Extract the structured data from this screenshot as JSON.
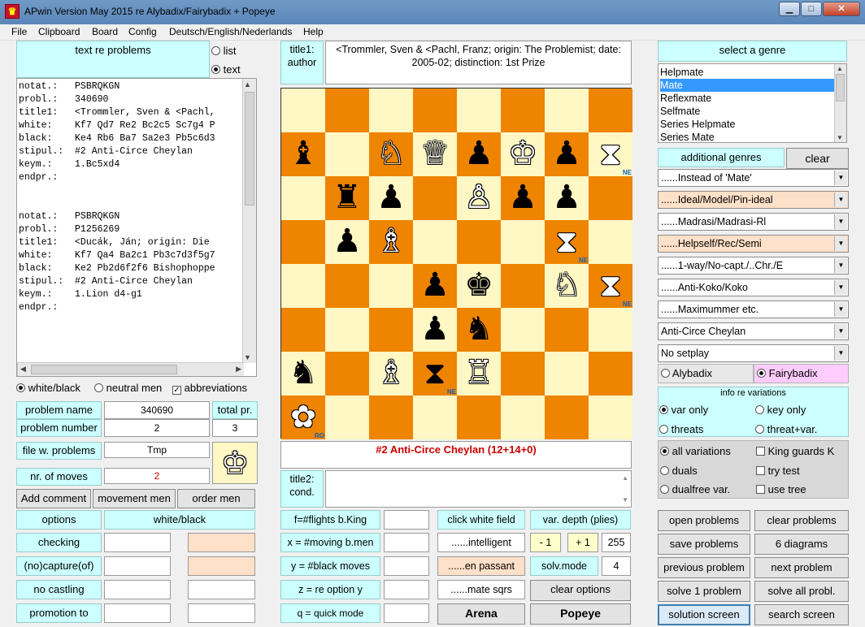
{
  "window": {
    "title": "APwin Version May 2015 re Alybadix/Fairybadix + Popeye"
  },
  "menu": [
    "File",
    "Clipboard",
    "Board",
    "Config",
    "Deutsch/English/Nederlands",
    "Help"
  ],
  "left": {
    "header": "text re problems",
    "radio_list": "list",
    "radio_text": "text",
    "problem_text": "notat.:   PSBRQKGN\nprobl.:   340690\ntitle1:   <Trommler, Sven & <Pachl,\nwhite:    Kf7 Qd7 Re2 Bc2c5 Sc7g4 P\nblack:    Ke4 Rb6 Ba7 Sa2e3 Pb5c6d3\nstipul.:  #2 Anti-Circe Cheylan\nkeym.:    1.Bc5xd4\nendpr.:\n\n\nnotat.:   PSBRQKGN\nprobl.:   P1256269\ntitle1:   <Ducák, Ján; origin: Die\nwhite:    Kf7 Qa4 Ba2c1 Pb3c7d3f5g7\nblack:    Ke2 Pb2d6f2f6 Bishophoppe\nstipul.:  #2 Anti-Circe Cheylan\nkeym.:    1.Lion d4-g1\nendpr.:",
    "opt_white_black": "white/black",
    "opt_neutral": "neutral men",
    "opt_abbrev": "abbreviations",
    "problem_name_label": "problem name",
    "problem_name_value": "340690",
    "total_pr_label": "total pr.",
    "problem_number_label": "problem number",
    "problem_number_value": "2",
    "total_pr_value": "3",
    "file_label": "file w. problems",
    "file_value": "Tmp",
    "moves_label": "nr. of moves",
    "moves_value": "2",
    "add_comment": "Add comment",
    "movement_men": "movement men",
    "order_men": "order men",
    "options": "options",
    "white_black": "white/black",
    "checking": "checking",
    "capture": "(no)capture(of)",
    "no_castling": "no castling",
    "promotion": "promotion to"
  },
  "center": {
    "title1_label": "title1:\nauthor",
    "title1_value": "<Trommler, Sven & <Pachl, Franz; origin: The Problemist; date: 2005-02; distinction: 1st Prize",
    "stipulation": "#2 Anti-Circe Cheylan (12+14+0)",
    "title2_label": "title2:\ncond.",
    "flights": "f=#flights b.King",
    "moving": "x = #moving b.men",
    "black_moves": "y = #black moves",
    "re_option": "z = re option y",
    "quick_mode": "q = quick mode",
    "click_white": "click white field",
    "intelligent": "......intelligent",
    "en_passant": "......en passant",
    "mate_sqrs": "......mate sqrs",
    "var_depth": "var. depth (plies)",
    "minus_one": "- 1",
    "plus_one": "+ 1",
    "depth_value": "255",
    "solv_mode": "solv.mode",
    "solv_value": "4",
    "clear_options": "clear options",
    "arena": "Arena",
    "popeye": "Popeye"
  },
  "board": {
    "rows": [
      [
        "",
        "",
        "",
        "",
        "",
        "",
        "",
        ""
      ],
      [
        "bB",
        "",
        "wS",
        "wQ",
        "bP",
        "wK",
        "bP",
        "wH"
      ],
      [
        "",
        "bR",
        "bP",
        "",
        "wP",
        "bP",
        "bP",
        ""
      ],
      [
        "",
        "bP",
        "wB",
        "",
        "",
        "",
        "wH",
        ""
      ],
      [
        "",
        "",
        "",
        "bP",
        "bK",
        "",
        "wS",
        "wH"
      ],
      [
        "",
        "",
        "",
        "bP",
        "bS",
        "",
        "",
        ""
      ],
      [
        "bS",
        "",
        "wB",
        "bH",
        "wR",
        "",
        "",
        ""
      ],
      [
        "wF",
        "",
        "",
        "",
        "",
        "",
        "",
        ""
      ]
    ],
    "marks": {
      "1-7": "NE",
      "3-6": "NE",
      "4-7": "NE",
      "6-3": "NE",
      "7-0": "RO"
    }
  },
  "right": {
    "select_genre": "select a genre",
    "genres": [
      "Helpmate",
      "Mate",
      "Reflexmate",
      "Selfmate",
      "Series Helpmate",
      "Series Mate"
    ],
    "selected_genre": "Mate",
    "additional_genres": "additional genres",
    "clear": "clear",
    "combos": [
      "......Instead of 'Mate'",
      "......Ideal/Model/Pin-ideal",
      "......Madrasi/Madrasi-Rl",
      "......Helpself/Rec/Semi",
      "......1-way/No-capt./..Chr./E",
      "......Anti-Koko/Koko",
      "......Maximummer etc.",
      "Anti-Circe Cheylan",
      "No setplay"
    ],
    "alybadix": "Alybadix",
    "fairybadix": "Fairybadix",
    "info_variations": "info re variations",
    "var_only": "var only",
    "key_only": "key only",
    "threats": "threats",
    "threat_var": "threat+var.",
    "all_variations": "all variations",
    "king_guards": "King guards K",
    "duals": "duals",
    "try_test": "try test",
    "dualfree": "dualfree var.",
    "use_tree": "use tree",
    "open_problems": "open problems",
    "clear_problems": "clear problems",
    "save_problems": "save problems",
    "six_diagrams": "6 diagrams",
    "previous_problem": "previous problem",
    "next_problem": "next problem",
    "solve_1": "solve 1 problem",
    "solve_all": "solve all probl.",
    "solution_screen": "solution screen",
    "search_screen": "search screen"
  }
}
